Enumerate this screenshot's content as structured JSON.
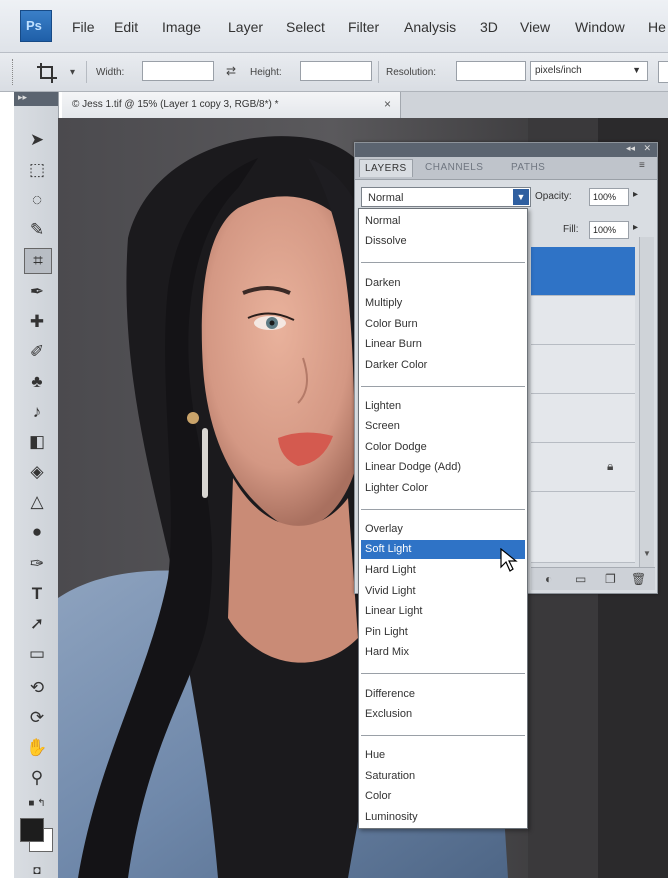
{
  "app": {
    "menu": [
      "File",
      "Edit",
      "Image",
      "Layer",
      "Select",
      "Filter",
      "Analysis",
      "3D",
      "View",
      "Window",
      "He"
    ],
    "logo_text": "Ps"
  },
  "options_bar": {
    "crop_icon": "crop-icon",
    "width_label": "Width:",
    "height_label": "Height:",
    "resolution_label": "Resolution:",
    "units_value": "pixels/inch",
    "width_value": "",
    "height_value": "",
    "resolution_value": ""
  },
  "document_tab": {
    "title": "© Jess 1.tif @ 15% (Layer 1 copy 3, RGB/8*) *",
    "close": "×"
  },
  "layers_panel": {
    "tabs": [
      "LAYERS",
      "CHANNELS",
      "PATHS"
    ],
    "blend_mode": "Normal",
    "opacity_label": "Opacity:",
    "opacity_value": "100%",
    "fill_label": "Fill:",
    "fill_value": "100%"
  },
  "blend_menu": {
    "groups": [
      [
        "Normal",
        "Dissolve"
      ],
      [
        "Darken",
        "Multiply",
        "Color Burn",
        "Linear Burn",
        "Darker Color"
      ],
      [
        "Lighten",
        "Screen",
        "Color Dodge",
        "Linear Dodge (Add)",
        "Lighter Color"
      ],
      [
        "Overlay",
        "Soft Light",
        "Hard Light",
        "Vivid Light",
        "Linear Light",
        "Pin Light",
        "Hard Mix"
      ],
      [
        "Difference",
        "Exclusion"
      ],
      [
        "Hue",
        "Saturation",
        "Color",
        "Luminosity"
      ]
    ],
    "highlighted": "Soft Light"
  },
  "colors": {
    "accent": "#2f73c6",
    "foreground": "#1d1d1d",
    "background": "#ffffff"
  }
}
